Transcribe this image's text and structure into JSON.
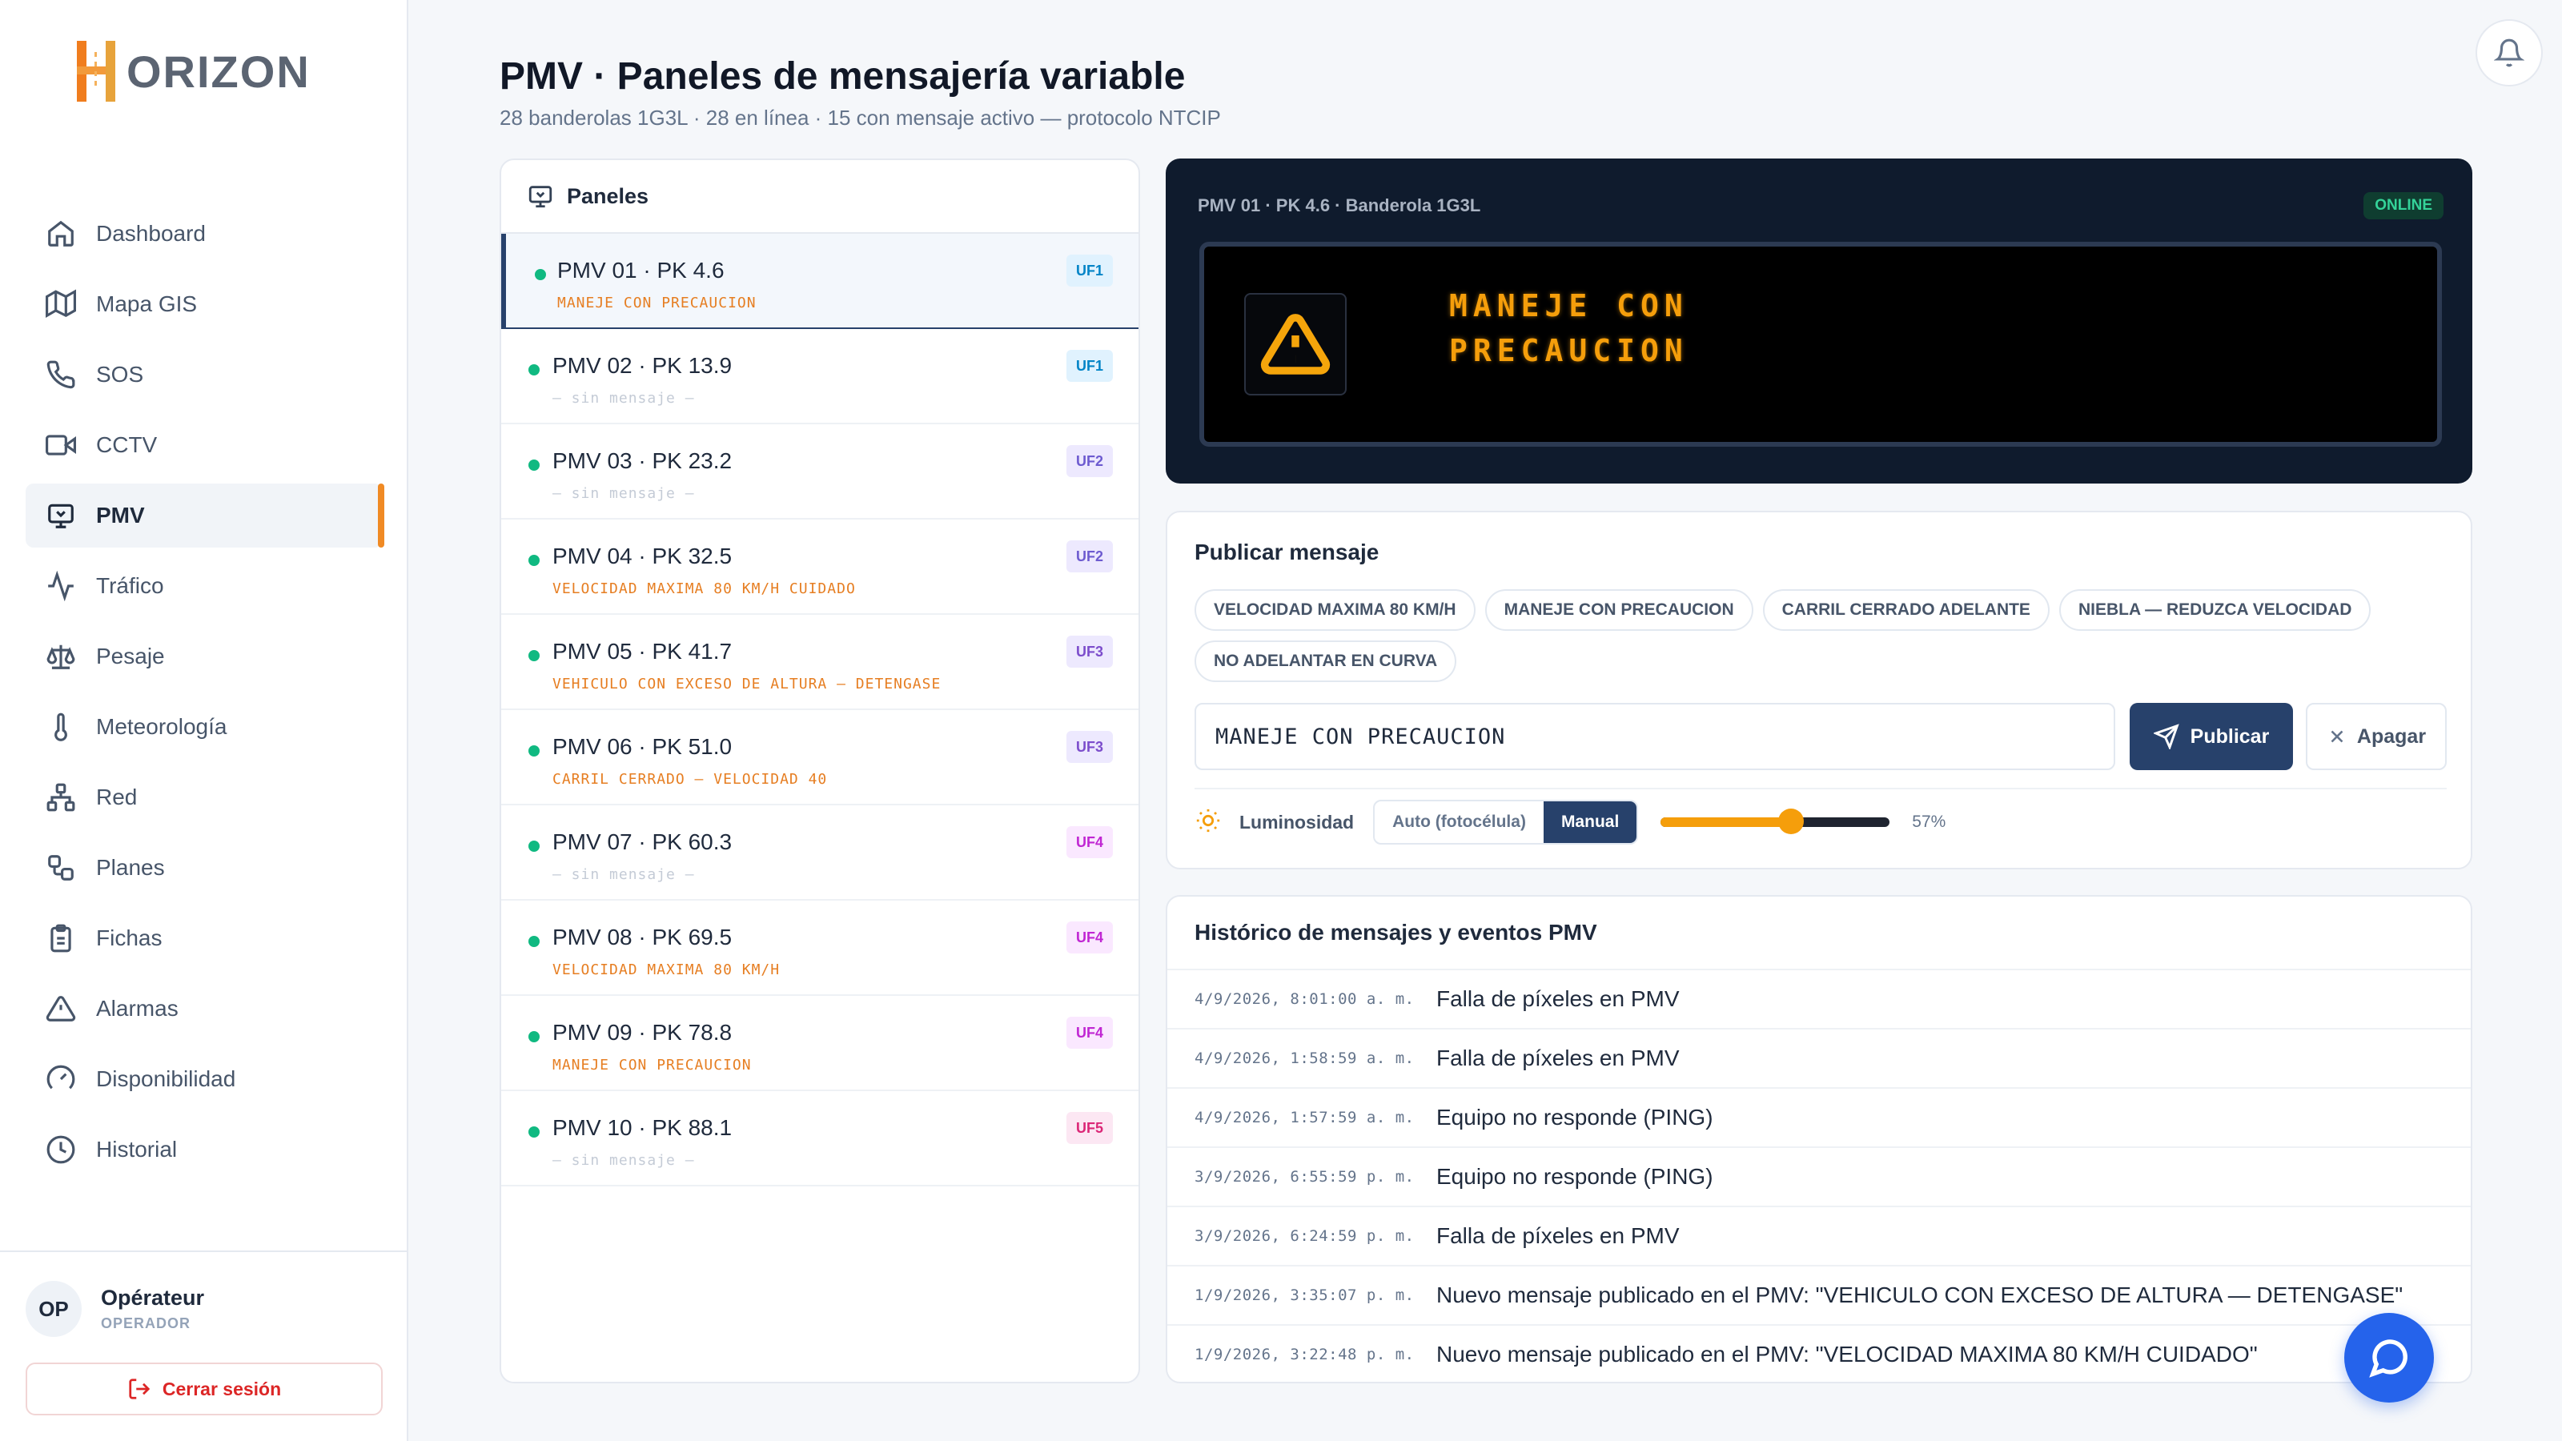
{
  "brand": {
    "name": "ORIZON"
  },
  "nav": [
    {
      "label": "Dashboard",
      "icon": "home-icon"
    },
    {
      "label": "Mapa GIS",
      "icon": "map-icon"
    },
    {
      "label": "SOS",
      "icon": "phone-icon"
    },
    {
      "label": "CCTV",
      "icon": "video-icon"
    },
    {
      "label": "PMV",
      "icon": "monitor-icon",
      "active": true
    },
    {
      "label": "Tráfico",
      "icon": "activity-icon"
    },
    {
      "label": "Pesaje",
      "icon": "scale-icon"
    },
    {
      "label": "Meteorología",
      "icon": "thermometer-icon"
    },
    {
      "label": "Red",
      "icon": "network-icon"
    },
    {
      "label": "Planes",
      "icon": "plans-icon"
    },
    {
      "label": "Fichas",
      "icon": "clipboard-icon"
    },
    {
      "label": "Alarmas",
      "icon": "alert-triangle-icon"
    },
    {
      "label": "Disponibilidad",
      "icon": "gauge-icon"
    },
    {
      "label": "Historial",
      "icon": "clock-icon"
    }
  ],
  "user": {
    "initials": "OP",
    "name": "Opérateur",
    "role": "OPERADOR"
  },
  "logout_label": "Cerrar sesión",
  "header": {
    "title": "PMV · Paneles de mensajería variable",
    "subtitle": "28 banderolas 1G3L · 28 en línea · 15 con mensaje activo — protocolo NTCIP"
  },
  "panels": {
    "title": "Paneles",
    "items": [
      {
        "name": "PMV 01 · PK 4.6",
        "message": "MANEJE CON PRECAUCION",
        "uf": "UF1",
        "active": true
      },
      {
        "name": "PMV 02 · PK 13.9",
        "message": "— sin mensaje —",
        "uf": "UF1",
        "empty": true
      },
      {
        "name": "PMV 03 · PK 23.2",
        "message": "— sin mensaje —",
        "uf": "UF2",
        "empty": true
      },
      {
        "name": "PMV 04 · PK 32.5",
        "message": "VELOCIDAD MAXIMA 80 KM/H CUIDADO",
        "uf": "UF2"
      },
      {
        "name": "PMV 05 · PK 41.7",
        "message": "VEHICULO CON EXCESO DE ALTURA — DETENGASE",
        "uf": "UF3"
      },
      {
        "name": "PMV 06 · PK 51.0",
        "message": "CARRIL CERRADO — VELOCIDAD 40",
        "uf": "UF3"
      },
      {
        "name": "PMV 07 · PK 60.3",
        "message": "— sin mensaje —",
        "uf": "UF4",
        "empty": true
      },
      {
        "name": "PMV 08 · PK 69.5",
        "message": "VELOCIDAD MAXIMA 80 KM/H",
        "uf": "UF4"
      },
      {
        "name": "PMV 09 · PK 78.8",
        "message": "MANEJE CON PRECAUCION",
        "uf": "UF4"
      },
      {
        "name": "PMV 10 · PK 88.1",
        "message": "— sin mensaje —",
        "uf": "UF5",
        "empty": true
      }
    ]
  },
  "uf_colors": {
    "UF1": {
      "bg": "#e0f2fe",
      "fg": "#0284c7"
    },
    "UF2": {
      "bg": "#ede9fe",
      "fg": "#6d5bd0"
    },
    "UF3": {
      "bg": "#ede9fe",
      "fg": "#7c4dcc"
    },
    "UF4": {
      "bg": "#fae8ff",
      "fg": "#c026d3"
    },
    "UF5": {
      "bg": "#fce7f3",
      "fg": "#db2777"
    }
  },
  "sign": {
    "label": "PMV 01 · PK 4.6 · Banderola 1G3L",
    "status": "ONLINE",
    "line1": "MANEJE CON",
    "line2": "PRECAUCION",
    "icon": "warning-icon"
  },
  "publish": {
    "title": "Publicar mensaje",
    "presets": [
      "VELOCIDAD MAXIMA 80 KM/H",
      "MANEJE CON PRECAUCION",
      "CARRIL CERRADO ADELANTE",
      "NIEBLA — REDUZCA VELOCIDAD",
      "NO ADELANTAR EN CURVA"
    ],
    "message_value": "MANEJE CON PRECAUCION",
    "publish_label": "Publicar",
    "off_label": "Apagar",
    "brightness_label": "Luminosidad",
    "mode_auto": "Auto (fotocélula)",
    "mode_manual": "Manual",
    "mode_selected": "Manual",
    "brightness_percent": 57,
    "brightness_text": "57%"
  },
  "history": {
    "title": "Histórico de mensajes y eventos PMV",
    "rows": [
      {
        "ts": "4/9/2026, 8:01:00 a. m.",
        "event": "Falla de píxeles en PMV"
      },
      {
        "ts": "4/9/2026, 1:58:59 a. m.",
        "event": "Falla de píxeles en PMV"
      },
      {
        "ts": "4/9/2026, 1:57:59 a. m.",
        "event": "Equipo no responde (PING)"
      },
      {
        "ts": "3/9/2026, 6:55:59 p. m.",
        "event": "Equipo no responde (PING)"
      },
      {
        "ts": "3/9/2026, 6:24:59 p. m.",
        "event": "Falla de píxeles en PMV"
      },
      {
        "ts": "1/9/2026, 3:35:07 p. m.",
        "event": "Nuevo mensaje publicado en el PMV: \"VEHICULO CON EXCESO DE ALTURA — DETENGASE\""
      },
      {
        "ts": "1/9/2026, 3:22:48 p. m.",
        "event": "Nuevo mensaje publicado en el PMV: \"VELOCIDAD MAXIMA 80 KM/H CUIDADO\""
      }
    ]
  },
  "colors": {
    "accent": "#f08a24",
    "primary": "#27416b",
    "led": "#f59e0b",
    "online": "#10b981",
    "chat": "#2563eb"
  }
}
